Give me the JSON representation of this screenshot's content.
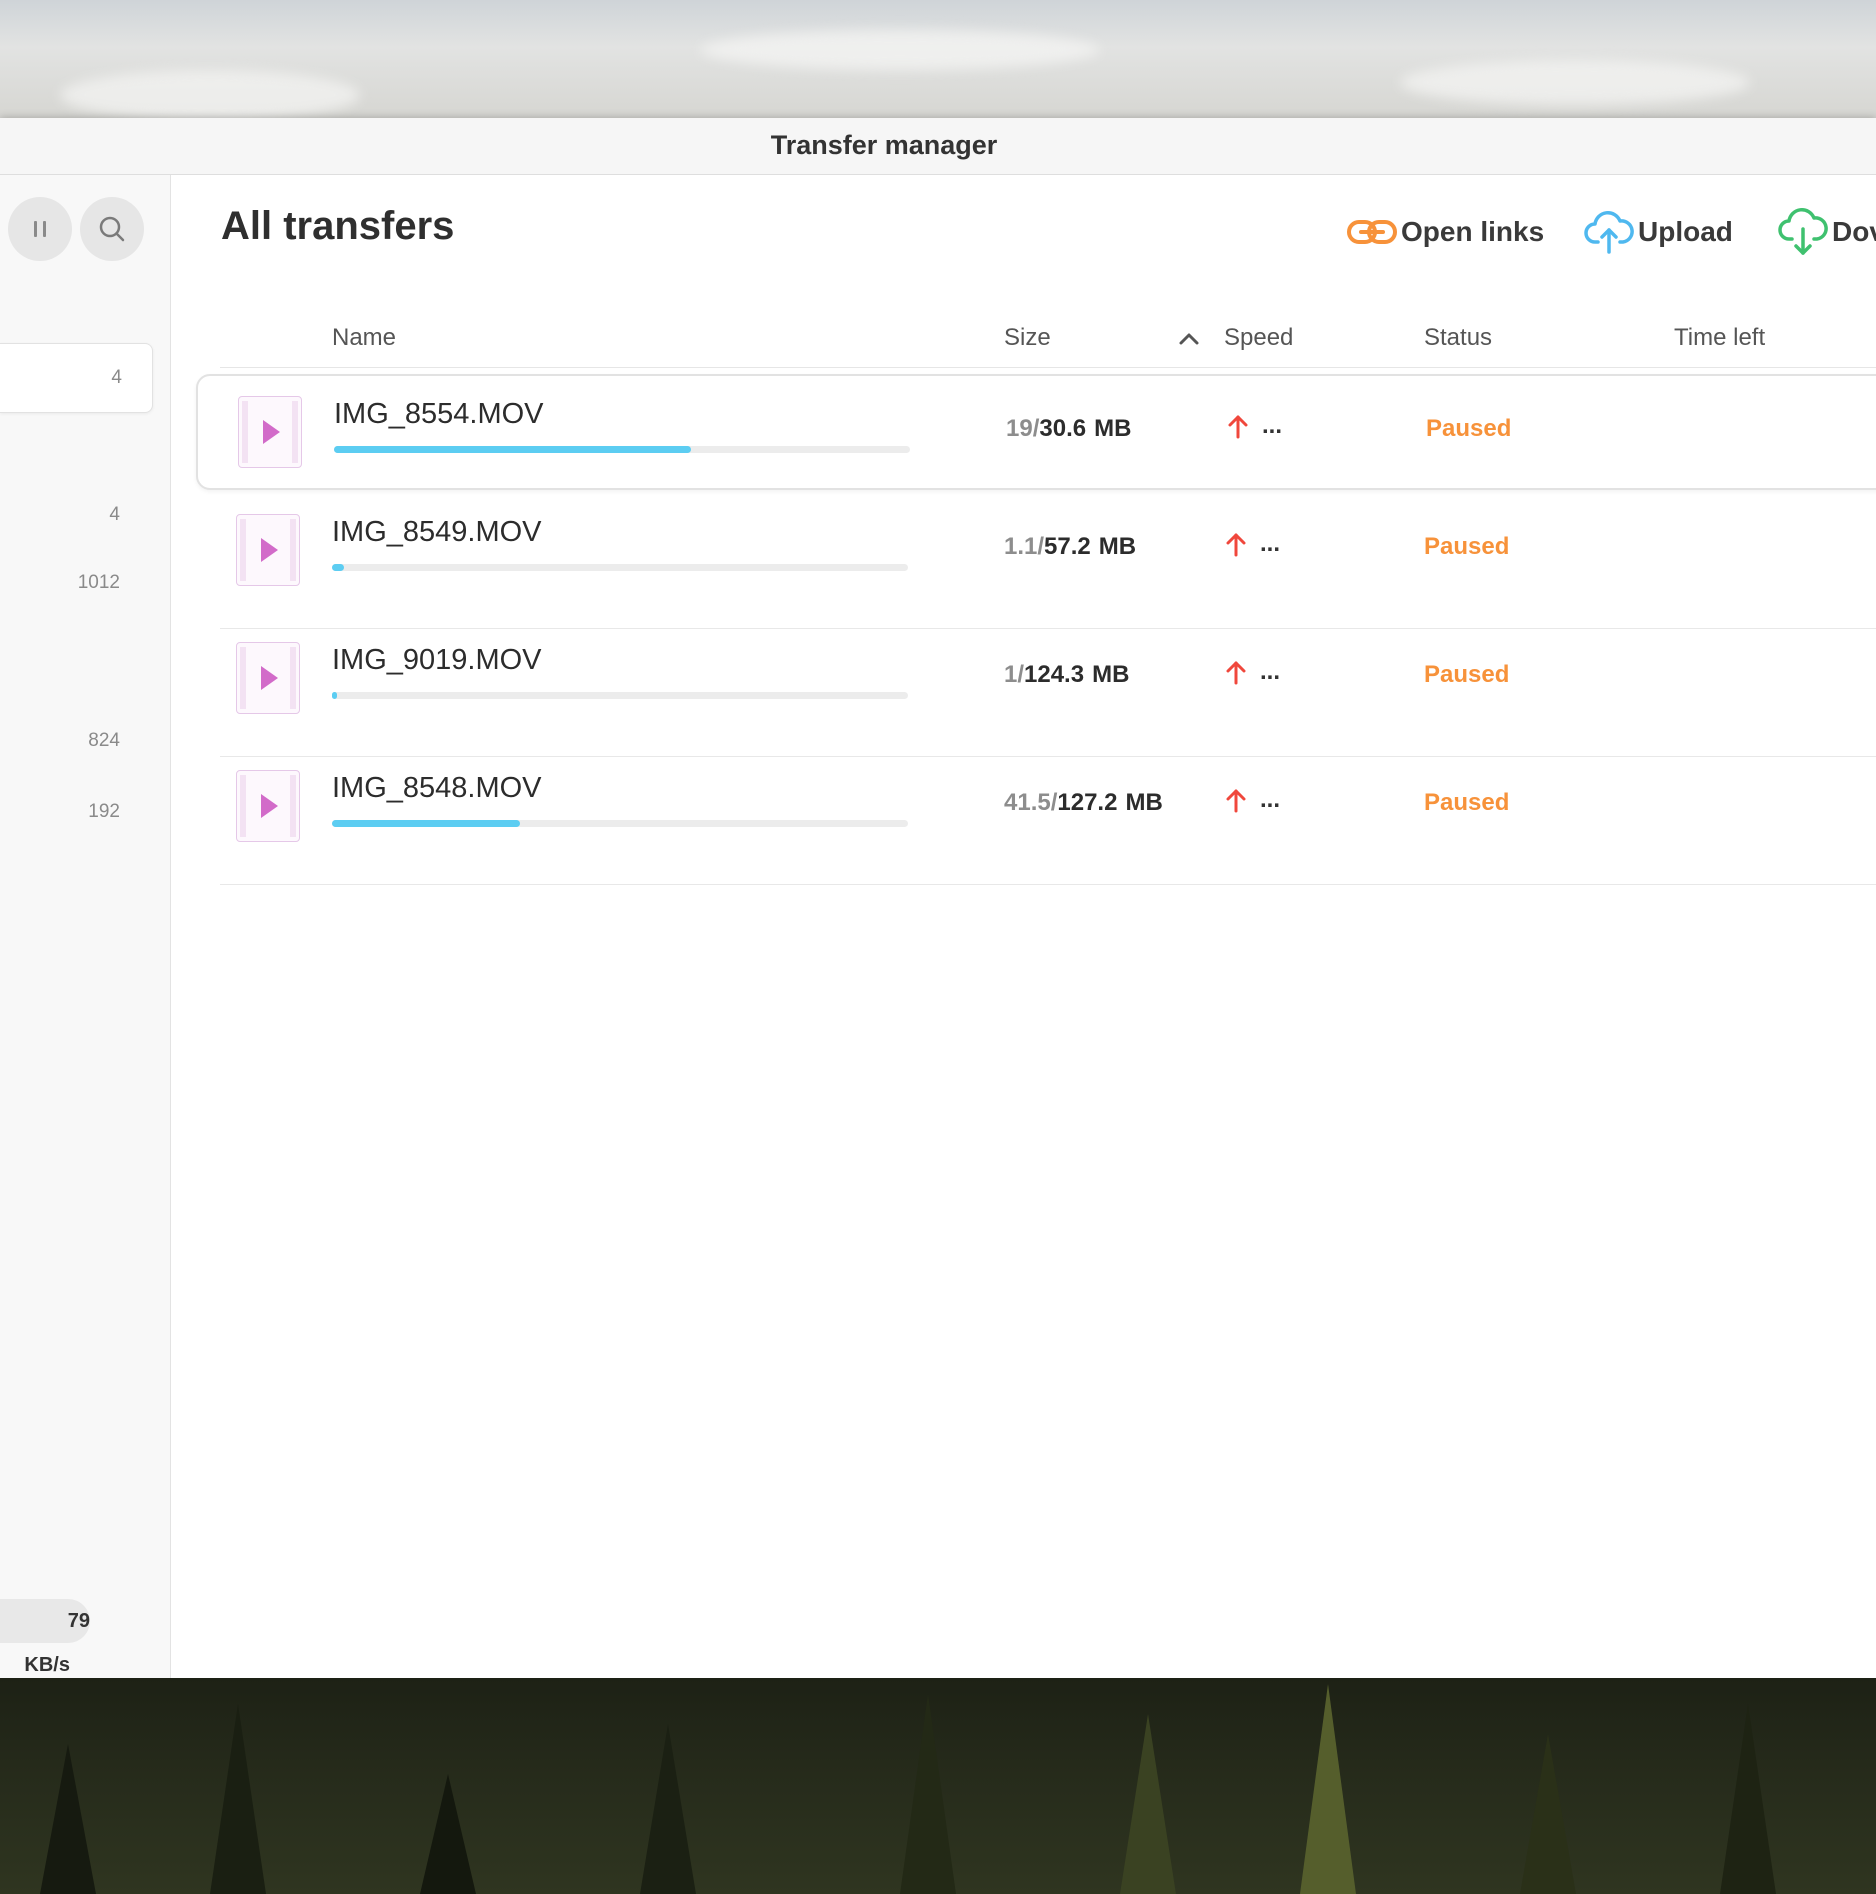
{
  "window": {
    "title": "Transfer manager"
  },
  "sidebar": {
    "buttons": [
      {
        "name": "pause-all-button",
        "icon": "pause-icon"
      },
      {
        "name": "search-button",
        "icon": "search-icon"
      }
    ],
    "counts": [
      "4",
      "4",
      "1012",
      "824",
      "192"
    ],
    "speed": "79 KB/s"
  },
  "main": {
    "title": "All transfers",
    "toolbar": {
      "open_links": "Open links",
      "upload": "Upload",
      "download": "Dov"
    },
    "columns": {
      "name": "Name",
      "size": "Size",
      "speed": "Speed",
      "status": "Status",
      "time_left": "Time left"
    },
    "transfers": [
      {
        "name": "IMG_8554.MOV",
        "done": "19/",
        "total": "30.6",
        "unit": "MB",
        "speed": "...",
        "status": "Paused",
        "progress": 0.62
      },
      {
        "name": "IMG_8549.MOV",
        "done": "1.1/",
        "total": "57.2",
        "unit": "MB",
        "speed": "...",
        "status": "Paused",
        "progress": 0.02
      },
      {
        "name": "IMG_9019.MOV",
        "done": "1/",
        "total": "124.3",
        "unit": "MB",
        "speed": "...",
        "status": "Paused",
        "progress": 0.008
      },
      {
        "name": "IMG_8548.MOV",
        "done": "41.5/",
        "total": "127.2",
        "unit": "MB",
        "speed": "...",
        "status": "Paused",
        "progress": 0.326
      }
    ]
  },
  "colors": {
    "accent_orange": "#f7923a",
    "upload_blue": "#4fb8ef",
    "download_green": "#3fc16f",
    "progress_blue": "#5ccdf2",
    "arrow_red": "#f0473c",
    "video_pink": "#d26bc9"
  }
}
